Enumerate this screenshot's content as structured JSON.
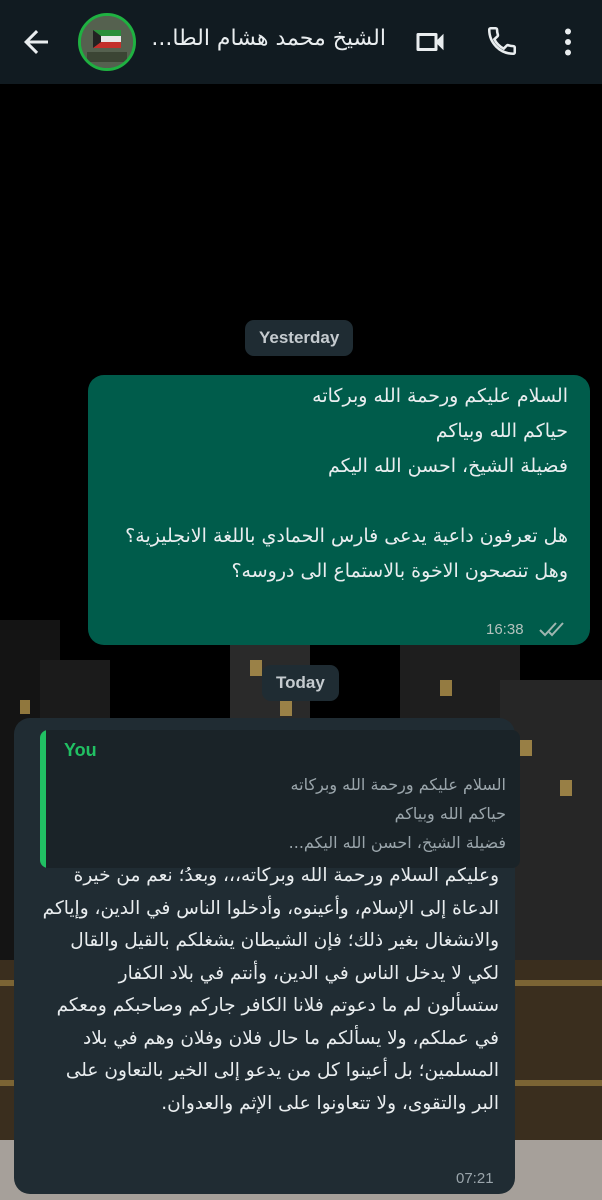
{
  "header": {
    "contact_name": "الشيخ محمد هشام الطا...",
    "back_icon": "arrow-left-icon",
    "video_icon": "video-call-icon",
    "phone_icon": "phone-icon",
    "menu_icon": "more-vert-icon"
  },
  "chat": {
    "date_yesterday": "Yesterday",
    "date_today": "Today",
    "messages": [
      {
        "direction": "outgoing",
        "text": "السلام عليكم ورحمة الله وبركاته\nحياكم الله وبياكم\nفضيلة الشيخ، احسن الله اليكم\n\nهل تعرفون داعية يدعى فارس الحمادي باللغة الانجليزية؟ وهل تنصحون الاخوة بالاستماع الى دروسه؟",
        "time": "16:38",
        "status_icon": "double-check-icon"
      },
      {
        "direction": "incoming",
        "quote_author": "You",
        "quote_text": "السلام عليكم ورحمة الله وبركاته\nحياكم الله وبياكم\nفضيلة الشيخ، احسن الله اليكم...",
        "text": "وعليكم السلام ورحمة الله وبركاته،،، وبعدُ؛ نعم من خيرة الدعاة إلى الإسلام، وأعينوه، وأدخلوا الناس في الدين، وإياكم والانشغال بغير ذلك؛ فإن الشيطان يشغلكم بالقيل والقال لكي لا يدخل الناس في الدين، وأنتم في بلاد الكفار ستسألون لم ما دعوتم فلانا الكافر جاركم وصاحبكم ومعكم في عملكم، ولا يسألكم ما حال فلان وفلان وهم في بلاد المسلمين؛ بل أعينوا كل من يدعو إلى الخير بالتعاون على البر والتقوى، ولا تتعاونوا على الإثم والعدوان.",
        "time": "07:21"
      }
    ]
  },
  "colors": {
    "header_bg": "#111b21",
    "outgoing_bubble": "#005c4b",
    "incoming_bubble": "#202c33",
    "accent_green": "#21c063",
    "read_ticks": "#9fb6b0"
  }
}
